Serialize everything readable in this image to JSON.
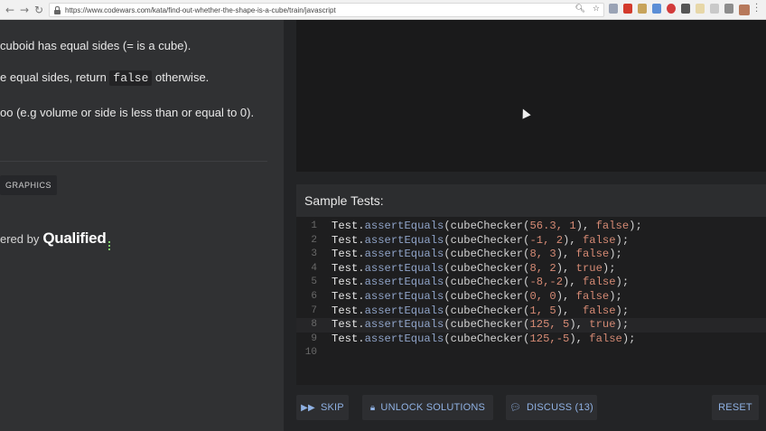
{
  "browser": {
    "url": "https://www.codewars.com/kata/find-out-whether-the-shape-is-a-cube/train/javascript"
  },
  "description": {
    "line1": "cuboid has equal sides (= is a cube).",
    "line2_pre": "e equal sides, return ",
    "line2_code": "false",
    "line2_post": " otherwise.",
    "line3": "oo (e.g volume or side is less than or equal to 0)."
  },
  "tags": [
    "GRAPHICS"
  ],
  "powered": {
    "prefix": "ered by",
    "brand": "Qualified"
  },
  "sample_tests": {
    "header": "Sample Tests:",
    "active_line": 8,
    "lines": [
      {
        "num": "1",
        "obj": "Test",
        "method": "assertEquals",
        "pre": "(cubeChecker(",
        "args": "56.3, 1",
        "post": "), ",
        "bool": "false",
        "end": ");"
      },
      {
        "num": "2",
        "obj": "Test",
        "method": "assertEquals",
        "pre": "(cubeChecker(",
        "args": "-1, 2",
        "post": "), ",
        "bool": "false",
        "end": ");"
      },
      {
        "num": "3",
        "obj": "Test",
        "method": "assertEquals",
        "pre": "(cubeChecker(",
        "args": "8, 3",
        "post": "), ",
        "bool": "false",
        "end": ");"
      },
      {
        "num": "4",
        "obj": "Test",
        "method": "assertEquals",
        "pre": "(cubeChecker(",
        "args": "8, 2",
        "post": "), ",
        "bool": "true",
        "end": ");"
      },
      {
        "num": "5",
        "obj": "Test",
        "method": "assertEquals",
        "pre": "(cubeChecker(",
        "args": "-8,-2",
        "post": "), ",
        "bool": "false",
        "end": ");"
      },
      {
        "num": "6",
        "obj": "Test",
        "method": "assertEquals",
        "pre": "(cubeChecker(",
        "args": "0, 0",
        "post": "), ",
        "bool": "false",
        "end": ");"
      },
      {
        "num": "7",
        "obj": "Test",
        "method": "assertEquals",
        "pre": "(cubeChecker(",
        "args": "1, 5",
        "post": "),  ",
        "bool": "false",
        "end": ");"
      },
      {
        "num": "8",
        "obj": "Test",
        "method": "assertEquals",
        "pre": "(cubeChecker(",
        "args": "125, 5",
        "post": "), ",
        "bool": "true",
        "end": ");"
      },
      {
        "num": "9",
        "obj": "Test",
        "method": "assertEquals",
        "pre": "(cubeChecker(",
        "args": "125,-5",
        "post": "), ",
        "bool": "false",
        "end": ");"
      },
      {
        "num": "10",
        "obj": "",
        "method": "",
        "pre": "",
        "args": "",
        "post": "",
        "bool": "",
        "end": ""
      }
    ]
  },
  "actions": {
    "skip": "SKIP",
    "unlock": "UNLOCK SOLUTIONS",
    "discuss": "DISCUSS (13)",
    "reset": "RESET"
  },
  "colors": {
    "accent": "#8fb1e3",
    "number": "#d58a74",
    "method": "#8fa3c8",
    "brand_dots": "#7fd56a"
  },
  "icons": {
    "skip": "fast-forward-icon",
    "unlock": "lock-icon",
    "discuss": "chat-bubble-icon"
  }
}
